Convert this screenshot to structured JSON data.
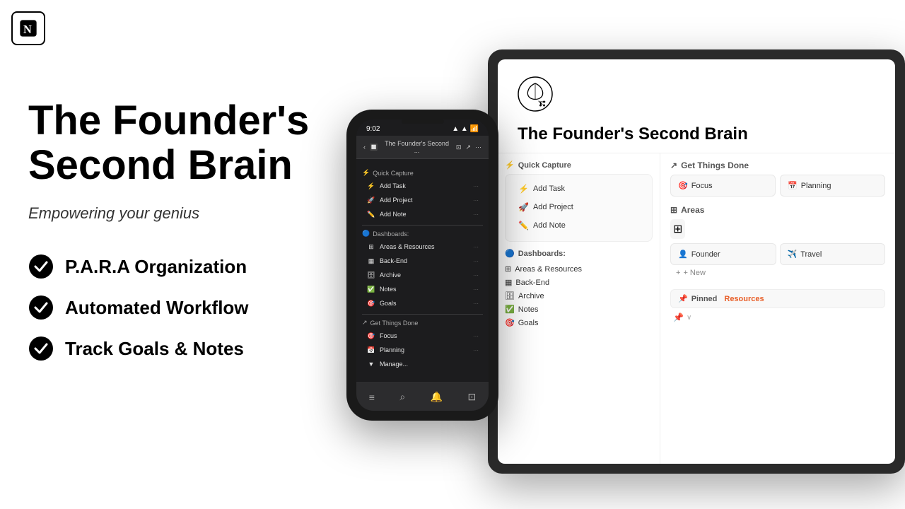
{
  "logo": {
    "symbol": "N",
    "aria": "Notion logo"
  },
  "hero": {
    "title_line1": "The Founder's",
    "title_line2": "Second Brain",
    "subtitle": "Empowering your genius",
    "features": [
      {
        "id": "para",
        "text": "P.A.R.A Organization"
      },
      {
        "id": "workflow",
        "text": "Automated Workflow"
      },
      {
        "id": "goals",
        "text": "Track Goals & Notes"
      }
    ]
  },
  "phone": {
    "status_time": "9:02",
    "nav_title": "The Founder's Second ...",
    "sections": [
      {
        "title": "Quick Capture",
        "icon": "⚡",
        "items": [
          {
            "icon": "⚡",
            "label": "Add Task"
          },
          {
            "icon": "🚀",
            "label": "Add Project"
          },
          {
            "icon": "✏️",
            "label": "Add Note"
          }
        ]
      },
      {
        "title": "Dashboards:",
        "icon": "🔵",
        "items": [
          {
            "icon": "⊞",
            "label": "Areas & Resources"
          },
          {
            "icon": "▦",
            "label": "Back-End"
          },
          {
            "icon": "🗄",
            "label": "Archive"
          },
          {
            "icon": "✅",
            "label": "Notes"
          },
          {
            "icon": "🎯",
            "label": "Goals"
          }
        ]
      },
      {
        "title": "Get Things Done",
        "icon": "↗",
        "items": [
          {
            "icon": "🎯",
            "label": "Focus"
          },
          {
            "icon": "📅",
            "label": "Planning"
          },
          {
            "icon": "▼",
            "label": "Manage..."
          }
        ]
      }
    ],
    "bottom_icons": [
      "≡",
      "⌕",
      "🔔",
      "⊡"
    ]
  },
  "tablet": {
    "brain_icon": "🧠",
    "title": "The Founder's Second Brain",
    "left_panel": {
      "quick_capture_title": "Quick Capture",
      "quick_capture_icon": "⚡",
      "buttons": [
        {
          "icon": "⚡",
          "label": "Add Task"
        },
        {
          "icon": "🚀",
          "label": "Add Project"
        },
        {
          "icon": "✏️",
          "label": "Add Note"
        }
      ],
      "dashboards_title": "Dashboards:",
      "dashboards_icon": "🔵",
      "dashboard_items": [
        {
          "icon": "⊞",
          "label": "Areas & Resources"
        },
        {
          "icon": "▦",
          "label": "Back-End"
        },
        {
          "icon": "🗄",
          "label": "Archive"
        },
        {
          "icon": "✅",
          "label": "Notes"
        },
        {
          "icon": "🎯",
          "label": "Goals"
        }
      ]
    },
    "right_panel": {
      "get_things_done_title": "Get Things Done",
      "get_things_done_icon": "↗",
      "gtd_items": [
        {
          "icon": "🎯",
          "label": "Focus"
        },
        {
          "icon": "📅",
          "label": "Planning"
        }
      ],
      "areas_title": "Areas",
      "areas_icon": "⊞",
      "areas_grid_icon": "⊞",
      "area_cards": [
        {
          "icon": "👤",
          "label": "Founder"
        },
        {
          "icon": "✈️",
          "label": "Travel"
        }
      ],
      "new_label": "+ New",
      "pinned_label": "Pinned",
      "resources_label": "Resources",
      "areas_resources_label": "Areas Resources"
    }
  }
}
